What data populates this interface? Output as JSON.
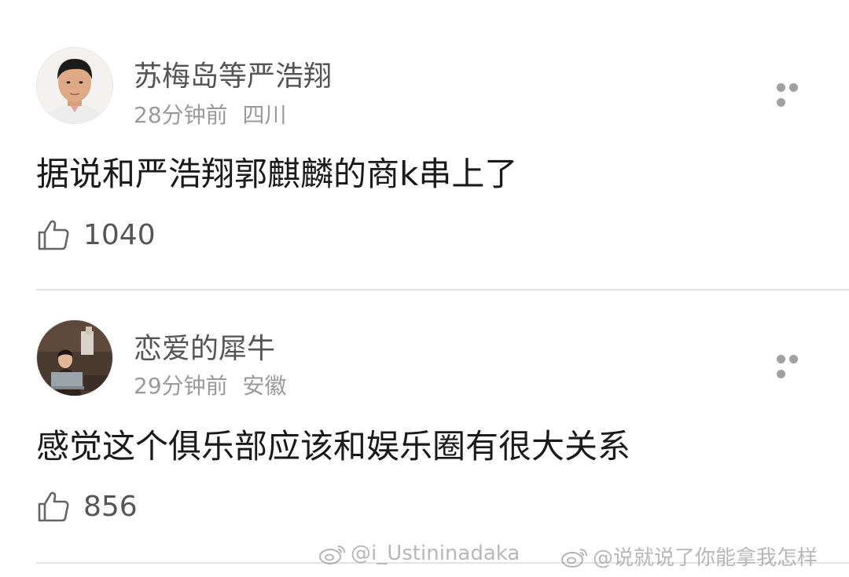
{
  "comments": [
    {
      "username": "苏梅岛等严浩翔",
      "time": "28分钟前",
      "location": "四川",
      "text": "据说和严浩翔郭麒麟的商k串上了",
      "likes": "1040",
      "avatar_icon": "avatar-young-man-photo"
    },
    {
      "username": "恋爱的犀牛",
      "time": "29分钟前",
      "location": "安徽",
      "text": "感觉这个俱乐部应该和娱乐圈有很大关系",
      "likes": "856",
      "avatar_icon": "avatar-woman-with-laptop-photo"
    }
  ],
  "watermarks": [
    "@i_Ustininadaka",
    "@说就说了你能拿我怎样"
  ],
  "colors": {
    "username": "#555555",
    "meta": "#9a9a9a",
    "text": "#1a1a1a",
    "divider": "#e4e4e4"
  }
}
